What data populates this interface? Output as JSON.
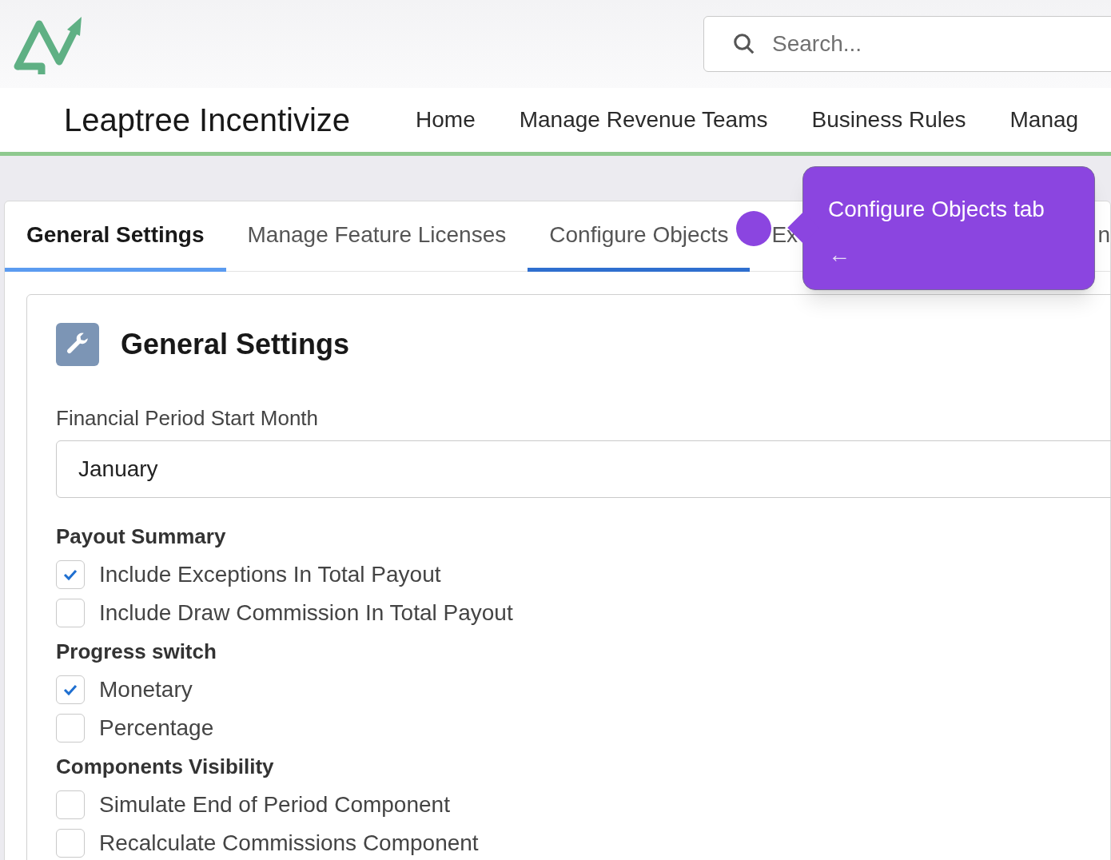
{
  "header": {
    "search": {
      "placeholder": "Search..."
    },
    "app_name": "Leaptree Incentivize",
    "nav": [
      {
        "label": "Home"
      },
      {
        "label": "Manage Revenue Teams"
      },
      {
        "label": "Business Rules"
      },
      {
        "label": "Manag"
      }
    ]
  },
  "tabs": [
    {
      "label": "General Settings",
      "selected": true,
      "highlighted": false
    },
    {
      "label": "Manage Feature Licenses",
      "selected": false,
      "highlighted": false
    },
    {
      "label": "Configure Objects",
      "selected": false,
      "highlighted": true
    },
    {
      "label": "Ex",
      "selected": false,
      "highlighted": false
    },
    {
      "label": "n",
      "selected": false,
      "highlighted": false
    }
  ],
  "tooltip": {
    "text": "Configure Objects tab",
    "back": "←"
  },
  "panel": {
    "title": "General Settings",
    "field": {
      "label": "Financial Period Start Month",
      "value": "January"
    },
    "groups": [
      {
        "title": "Payout Summary",
        "options": [
          {
            "label": "Include Exceptions In Total Payout",
            "checked": true
          },
          {
            "label": "Include Draw Commission In Total Payout",
            "checked": false
          }
        ]
      },
      {
        "title": "Progress switch",
        "options": [
          {
            "label": "Monetary",
            "checked": true
          },
          {
            "label": "Percentage",
            "checked": false
          }
        ]
      },
      {
        "title": "Components Visibility",
        "options": [
          {
            "label": "Simulate End of Period Component",
            "checked": false
          },
          {
            "label": "Recalculate Commissions Component",
            "checked": false
          }
        ]
      }
    ]
  }
}
